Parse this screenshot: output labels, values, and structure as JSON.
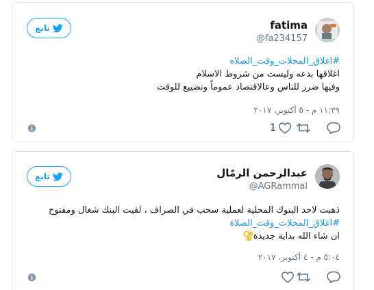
{
  "tweets": [
    {
      "name": "fatima",
      "handle": "@fa234157",
      "follow_label": "تابع",
      "text_lines": [
        "#اغلاق_المحلات_وقت_الصلاه",
        "اغلاقها بدعه وليست من شروط الاسلام",
        "وفيها ضرر للناس وعالاقتصاد عموماً وتضييع للوقت"
      ],
      "timestamp": "١١:٣٩ م - ٥ أكتوبر، ٢٠١٧",
      "like_count": "1"
    },
    {
      "name": "عبدالرحمن الرمّال",
      "handle": "@AGRammal",
      "follow_label": "تابع",
      "text_lines": [
        "ذهبت لاحد البنوك المحلية لعملية سحب في الصراف ، لقيت البنك شغال ومفتوح",
        "#اغلاق_المحلات_وقت_الصلاة",
        "ان شاء الله بداية جديدة"
      ],
      "timestamp": "٥:٠٤ م - ٤ أكتوبر، ٢٠١٧",
      "like_count": ""
    }
  ],
  "colors": {
    "accent": "#1da1f2",
    "hashtag": "#1b95e0",
    "muted": "#657786",
    "border": "#e1e8ed"
  },
  "icons": {
    "follow": "twitter-bird-icon",
    "info": "info-icon",
    "like": "heart-icon",
    "retweet": "retweet-icon",
    "reply": "reply-icon",
    "emoji": "ok-hand-emoji"
  }
}
